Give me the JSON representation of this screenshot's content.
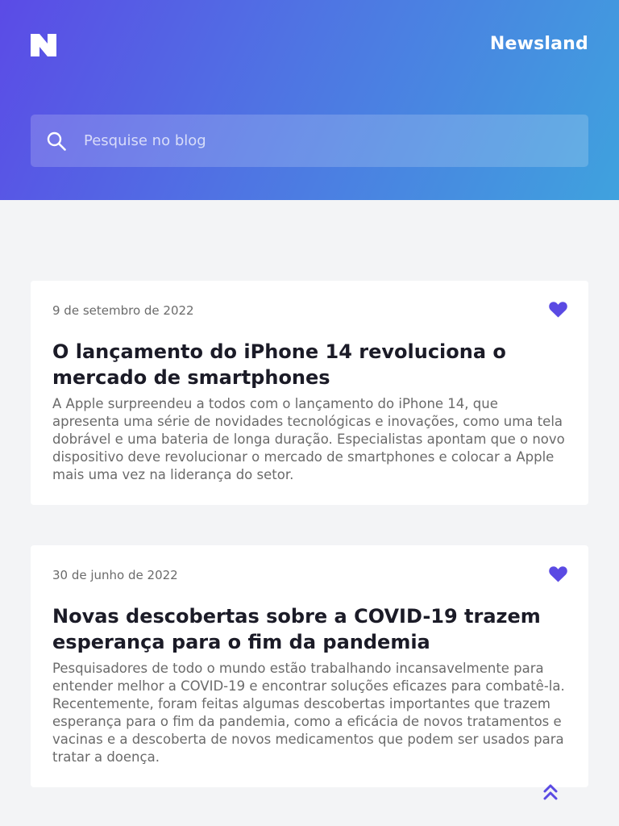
{
  "brand": {
    "logo_icon": "n-logo-icon",
    "name": "Newsland"
  },
  "search": {
    "icon": "search-icon",
    "placeholder": "Pesquise no blog"
  },
  "colors": {
    "header_gradient": [
      "#5b4be6",
      "#4f74e3",
      "#3fa2de"
    ],
    "accent": "#5a4ae3",
    "background": "#f3f4f6"
  },
  "posts": [
    {
      "date": "9 de setembro de 2022",
      "title": "O lançamento do iPhone 14 revoluciona o mercado de smartphones",
      "excerpt": "A Apple surpreendeu a todos com o lançamento do iPhone 14, que apresenta uma série de novidades tecnológicas e inovações, como uma tela dobrável e uma bateria de longa duração. Especialistas apontam que o novo dispositivo deve revolucionar o mercado de smartphones e colocar a Apple mais uma vez na liderança do setor.",
      "favorite_icon": "heart-icon"
    },
    {
      "date": "30 de junho de 2022",
      "title": "Novas descobertas sobre a COVID-19 trazem esperança para o fim da pandemia",
      "excerpt": "Pesquisadores de todo o mundo estão trabalhando incansavelmente para entender melhor a COVID-19 e encontrar soluções eficazes para combatê-la. Recentemente, foram feitas algumas descobertas importantes que trazem esperança para o fim da pandemia, como a eficácia de novos tratamentos e vacinas e a descoberta de novos medicamentos que podem ser usados para tratar a doença.",
      "favorite_icon": "heart-icon"
    }
  ],
  "scroll_top_icon": "double-chevron-up-icon"
}
